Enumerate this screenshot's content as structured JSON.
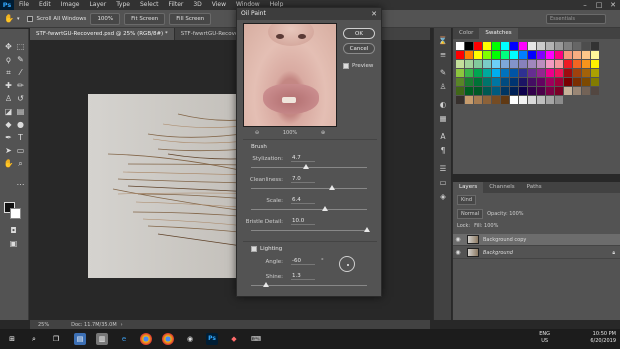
{
  "menubar": {
    "logo": "Ps",
    "items": [
      "File",
      "Edit",
      "Image",
      "Layer",
      "Type",
      "Select",
      "Filter",
      "3D",
      "View",
      "Window",
      "Help"
    ]
  },
  "optbar": {
    "scroll_all_label": "Scroll All Windows",
    "buttons": [
      "100%",
      "Fit Screen",
      "Fill Screen"
    ],
    "search_placeholder": "Essentials"
  },
  "doctabs": [
    {
      "label": "STF-fwwrtGU-Recovered.psd @ 25% (RGB/8#) *",
      "active": true
    },
    {
      "label": "STF-fwwrtGU-Recovered.tga",
      "active": false
    }
  ],
  "statusbar": {
    "zoom": "25%",
    "doc": "Doc: 11.7M/35.0M"
  },
  "swatches_panel": {
    "tabs": [
      {
        "label": "Color",
        "active": false
      },
      {
        "label": "Swatches",
        "active": true
      }
    ],
    "colors": [
      "#ffffff",
      "#000000",
      "#ff0000",
      "#ffff00",
      "#00ff00",
      "#00ffff",
      "#0000ff",
      "#ff00ff",
      "#e6e6e6",
      "#cccccc",
      "#b3b3b3",
      "#999999",
      "#808080",
      "#666666",
      "#4d4d4d",
      "#333333",
      "#ff0000",
      "#ff7f00",
      "#ffff00",
      "#7fff00",
      "#00ff00",
      "#00ff7f",
      "#00ffff",
      "#007fff",
      "#0000ff",
      "#7f00ff",
      "#ff00ff",
      "#ff007f",
      "#f7977a",
      "#f9ad81",
      "#fdc68a",
      "#fff79a",
      "#c4df9b",
      "#a3d39c",
      "#82ca9d",
      "#7accc8",
      "#6dcff6",
      "#7da7d9",
      "#8393ca",
      "#8781bd",
      "#a187be",
      "#bc8dbf",
      "#f49ac2",
      "#f6989d",
      "#ed1c24",
      "#f26522",
      "#f7941d",
      "#fff200",
      "#8dc63f",
      "#39b54a",
      "#00a651",
      "#00a99d",
      "#00aeef",
      "#0072bc",
      "#0054a6",
      "#2e3192",
      "#662d91",
      "#92278f",
      "#ec008c",
      "#ed145b",
      "#9e0b0f",
      "#a0410d",
      "#a36209",
      "#aba000",
      "#598527",
      "#1a7b30",
      "#007236",
      "#00746b",
      "#0076a3",
      "#004b80",
      "#003471",
      "#1b1464",
      "#440e62",
      "#630460",
      "#9e005d",
      "#9e0039",
      "#790000",
      "#7b2e00",
      "#7d4900",
      "#827b00",
      "#406618",
      "#005e20",
      "#005826",
      "#005952",
      "#005b7f",
      "#003663",
      "#002157",
      "#0d004c",
      "#32004b",
      "#4b0049",
      "#7b0046",
      "#7a0026",
      "#c7b299",
      "#998675",
      "#736357",
      "#534741",
      "#37302d",
      "#c69c6d",
      "#a67c52",
      "#8c6239",
      "#754c24",
      "#603913",
      "#ffffff",
      "#f2f2f2",
      "#d9d9d9",
      "#bfbfbf",
      "#a6a6a6",
      "#8c8c8c"
    ]
  },
  "layers_panel": {
    "tabs": [
      {
        "label": "Layers",
        "active": true
      },
      {
        "label": "Channels",
        "active": false
      },
      {
        "label": "Paths",
        "active": false
      }
    ],
    "kind_label": "Kind",
    "blend_mode": "Normal",
    "opacity_label": "Opacity: 100%",
    "lock_label": "Lock:",
    "fill_label": "Fill: 100%",
    "layers": [
      {
        "name": "Background copy",
        "selected": true
      },
      {
        "name": "Background",
        "selected": false
      }
    ]
  },
  "dialog": {
    "title": "Oil Paint",
    "ok_label": "OK",
    "cancel_label": "Cancel",
    "preview_label": "Preview",
    "zoom_level": "100%",
    "brush_heading": "Brush",
    "params": [
      {
        "label": "Stylization:",
        "value": "4.7",
        "fraction": 0.47
      },
      {
        "label": "Cleanliness:",
        "value": "7.0",
        "fraction": 0.7
      },
      {
        "label": "Scale:",
        "value": "6.4",
        "fraction": 0.64
      },
      {
        "label": "Bristle Detail:",
        "value": "10.0",
        "fraction": 1.0
      }
    ],
    "lighting_label": "Lighting",
    "angle_label": "Angle:",
    "angle_value": "-60",
    "angle_unit": "°",
    "shine_label": "Shine:",
    "shine_value": "1.3",
    "shine_fraction": 0.13
  },
  "taskbar": {
    "lang_top": "ENG",
    "lang_bottom": "US",
    "time": "10:50 PM",
    "date": "6/20/2019"
  }
}
